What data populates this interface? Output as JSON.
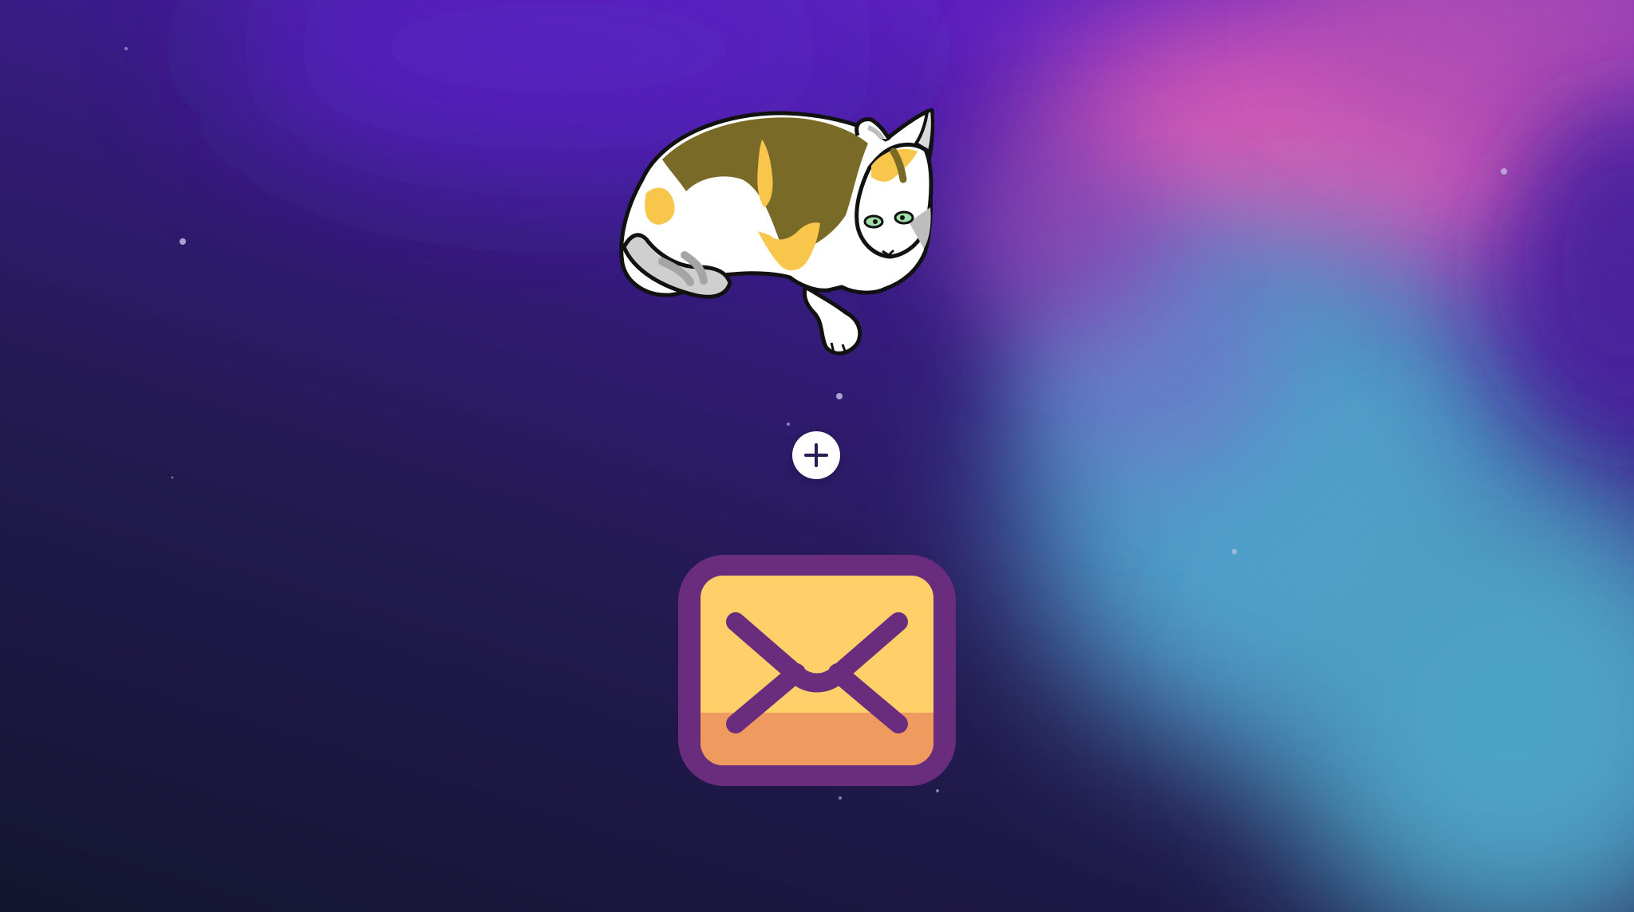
{
  "scene": {
    "background_colors": {
      "deep_navy": "#141634",
      "violet": "#5a20bd",
      "magenta": "#d35cb6",
      "cyan": "#4fa1c8"
    }
  },
  "illustration": {
    "icon": "calico-cat-lying-icon"
  },
  "add_button": {
    "icon": "plus-icon",
    "color": "#ffffff",
    "glyph_color": "#2a1a55"
  },
  "mail_app": {
    "icon": "envelope-icon",
    "frame_color": "#6a2d7e",
    "body_color": "#ffcf6a",
    "bottom_color": "#ef9a5e"
  }
}
